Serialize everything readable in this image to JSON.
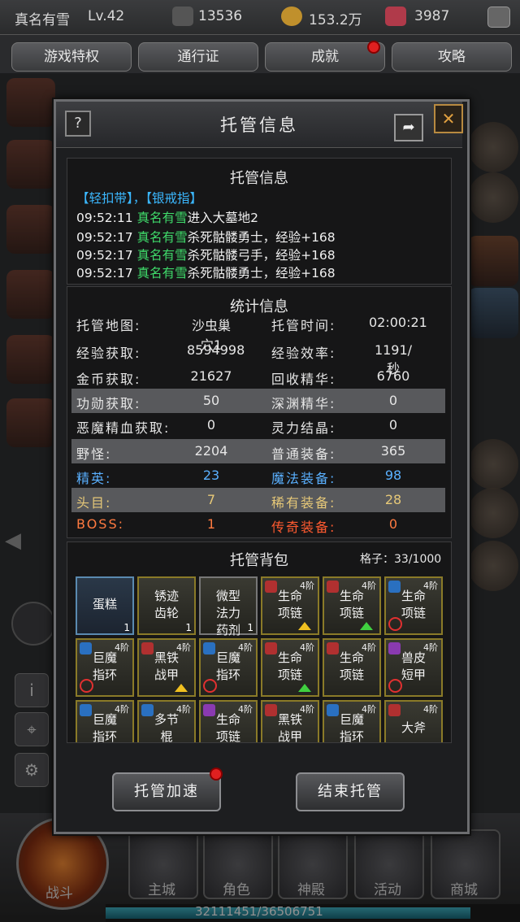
{
  "topbar": {
    "player_name": "真名有雪",
    "level": "Lv.42",
    "combat_power": "13536",
    "gold": "153.2万",
    "gems": "3987"
  },
  "menu_tabs": [
    "游戏特权",
    "通行证",
    "成就",
    "攻略"
  ],
  "bg_multiplier": "×1",
  "dialog": {
    "title": "托管信息",
    "help": "?",
    "close": "✕",
    "share": "➦"
  },
  "log": {
    "title": "托管信息",
    "pickup_line": "【轻扣带】，【银戒指】",
    "lines": [
      {
        "time": "09:52:11",
        "name": "真名有雪",
        "text": "进入大墓地2"
      },
      {
        "time": "09:52:17",
        "name": "真名有雪",
        "text": "杀死骷髅勇士，经验+168"
      },
      {
        "time": "09:52:17",
        "name": "真名有雪",
        "text": "杀死骷髅弓手，经验+168"
      },
      {
        "time": "09:52:17",
        "name": "真名有雪",
        "text": "杀死骷髅勇士，经验+168"
      }
    ]
  },
  "stats": {
    "title": "统计信息",
    "rows": [
      {
        "l1": "托管地图:",
        "v1": "沙虫巢穴1",
        "l2": "托管时间:",
        "v2": "02:00:21"
      },
      {
        "l1": "经验获取:",
        "v1": "8594998",
        "l2": "经验效率:",
        "v2": "1191/秒"
      },
      {
        "l1": "金币获取:",
        "v1": "21627",
        "l2": "回收精华:",
        "v2": "6760"
      },
      {
        "l1": "功勋获取:",
        "v1": "50",
        "l2": "深渊精华:",
        "v2": "0"
      },
      {
        "l1": "恶魔精血获取:",
        "v1": "0",
        "l2": "灵力结晶:",
        "v2": "0"
      },
      {
        "l1": "野怪:",
        "v1": "2204",
        "l2": "普通装备:",
        "v2": "365"
      },
      {
        "l1": "精英:",
        "v1": "23",
        "l2": "魔法装备:",
        "v2": "98"
      },
      {
        "l1": "头目:",
        "v1": "7",
        "l2": "稀有装备:",
        "v2": "28"
      },
      {
        "l1": "BOSS:",
        "v1": "1",
        "l2": "传奇装备:",
        "v2": "0"
      }
    ],
    "row_colors": [
      "#e6e6e6",
      "#e6e6e6",
      "#e6e6e6",
      "#e6e6e6",
      "#e6e6e6",
      "#e6e6e6",
      "#5ab0ff",
      "#e6c878",
      "#ff7a40"
    ],
    "right_label_colors": [
      "#e6e6e6",
      "#e6e6e6",
      "#e6e6e6",
      "#e6e6e6",
      "#e6e6e6",
      "#e6e6e6",
      "#5ab0ff",
      "#e6c878",
      "#ff5a30"
    ]
  },
  "bag": {
    "title": "托管背包",
    "capacity_label": "格子：33/1000",
    "items": [
      {
        "name": "蛋糕",
        "count": "1",
        "level": "",
        "type": "",
        "border": "#5a8ab0",
        "arrow": "",
        "banned": false
      },
      {
        "name": "锈迹齿轮",
        "count": "1",
        "level": "",
        "type": "",
        "border": "#8a7a28",
        "arrow": "",
        "banned": false
      },
      {
        "name": "微型法力药剂",
        "count": "1",
        "level": "",
        "type": "",
        "border": "#777777",
        "arrow": "",
        "banned": false
      },
      {
        "name": "生命项链",
        "count": "",
        "level": "4阶",
        "type": "red",
        "border": "#8a7a28",
        "arrow": "yellow",
        "banned": false
      },
      {
        "name": "生命项链",
        "count": "",
        "level": "4阶",
        "type": "red",
        "border": "#8a7a28",
        "arrow": "green",
        "banned": false
      },
      {
        "name": "生命项链",
        "count": "",
        "level": "4阶",
        "type": "blue",
        "border": "#8a7a28",
        "arrow": "",
        "banned": true
      },
      {
        "name": "巨魔指环",
        "count": "",
        "level": "4阶",
        "type": "blue",
        "border": "#8a7a28",
        "arrow": "",
        "banned": true
      },
      {
        "name": "黑铁战甲",
        "count": "",
        "level": "4阶",
        "type": "red",
        "border": "#8a7a28",
        "arrow": "yellow",
        "banned": false
      },
      {
        "name": "巨魔指环",
        "count": "",
        "level": "4阶",
        "type": "blue",
        "border": "#8a7a28",
        "arrow": "",
        "banned": true
      },
      {
        "name": "生命项链",
        "count": "",
        "level": "4阶",
        "type": "red",
        "border": "#8a7a28",
        "arrow": "green",
        "banned": false
      },
      {
        "name": "生命项链",
        "count": "",
        "level": "4阶",
        "type": "red",
        "border": "#8a7a28",
        "arrow": "",
        "banned": false
      },
      {
        "name": "兽皮短甲",
        "count": "",
        "level": "4阶",
        "type": "purple",
        "border": "#8a7a28",
        "arrow": "",
        "banned": true
      },
      {
        "name": "巨魔指环",
        "count": "",
        "level": "4阶",
        "type": "blue",
        "border": "#8a7a28",
        "arrow": "",
        "banned": false
      },
      {
        "name": "多节棍",
        "count": "",
        "level": "4阶",
        "type": "blue",
        "border": "#8a7a28",
        "arrow": "",
        "banned": false
      },
      {
        "name": "生命项链",
        "count": "",
        "level": "4阶",
        "type": "purple",
        "border": "#8a7a28",
        "arrow": "",
        "banned": false
      },
      {
        "name": "黑铁战甲",
        "count": "",
        "level": "4阶",
        "type": "red",
        "border": "#8a7a28",
        "arrow": "",
        "banned": false
      },
      {
        "name": "巨魔指环",
        "count": "",
        "level": "4阶",
        "type": "blue",
        "border": "#8a7a28",
        "arrow": "",
        "banned": false
      },
      {
        "name": "大斧",
        "count": "",
        "level": "4阶",
        "type": "red",
        "border": "#8a7a28",
        "arrow": "",
        "banned": false
      }
    ]
  },
  "buttons": {
    "speedup": "托管加速",
    "end": "结束托管"
  },
  "bottom_nav": [
    "战斗",
    "主城",
    "角色",
    "神殿",
    "活动",
    "商城"
  ],
  "exp": {
    "text": "32111451/36506751",
    "progress": 0.88
  }
}
